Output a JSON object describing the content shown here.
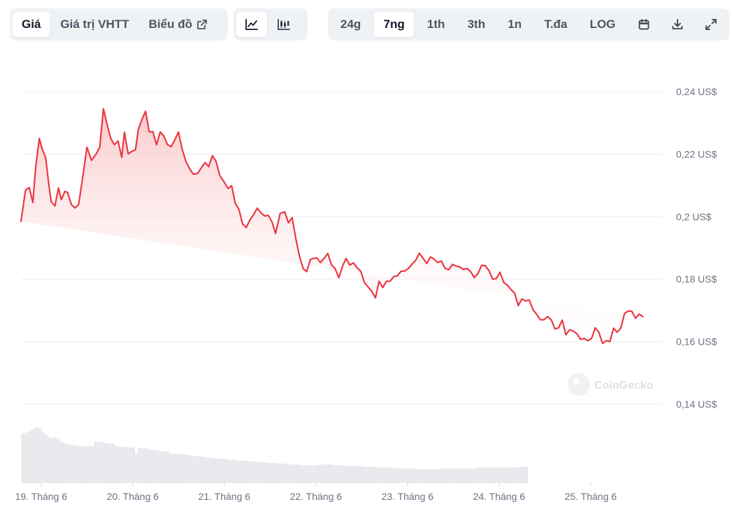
{
  "toolbar": {
    "tabs": [
      {
        "label": "Giá",
        "active": true
      },
      {
        "label": "Giá trị VHTT",
        "active": false
      },
      {
        "label": "Biểu đồ",
        "active": false
      }
    ],
    "chart_types": [
      {
        "icon": "line-chart-icon",
        "active": true
      },
      {
        "icon": "candlestick-chart-icon",
        "active": false
      }
    ],
    "ranges": [
      {
        "label": "24g",
        "active": false
      },
      {
        "label": "7ng",
        "active": true
      },
      {
        "label": "1th",
        "active": false
      },
      {
        "label": "3th",
        "active": false
      },
      {
        "label": "1n",
        "active": false
      },
      {
        "label": "T.đa",
        "active": false
      },
      {
        "label": "LOG",
        "active": false
      }
    ],
    "tools": [
      "calendar-icon",
      "download-icon",
      "expand-icon"
    ]
  },
  "watermark": "CoinGecko",
  "colors": {
    "line": "#ea3943",
    "fill_top": "#fbc7c9",
    "grid": "#eceef1",
    "volume": "#e6e8ec",
    "axis_text": "#6b7280"
  },
  "chart_data": {
    "type": "area",
    "y_tick_labels": [
      "0,24 US$",
      "0,22 US$",
      "0,2 US$",
      "0,18 US$",
      "0,16 US$",
      "0,14 US$"
    ],
    "y_ticks": [
      0.24,
      0.22,
      0.2,
      0.18,
      0.16,
      0.14
    ],
    "ylim": [
      0.14,
      0.24
    ],
    "xlim": [
      18.78,
      25.78
    ],
    "x_tick_labels": [
      "19. Tháng 6",
      "20. Tháng 6",
      "21. Tháng 6",
      "22. Tháng 6",
      "23. Tháng 6",
      "24. Tháng 6",
      "25. Tháng 6"
    ],
    "x_ticks": [
      19,
      20,
      21,
      22,
      23,
      24,
      25
    ],
    "grid": true,
    "price": {
      "x": [
        18.78,
        18.83,
        18.87,
        18.91,
        18.94,
        18.98,
        19.01,
        19.05,
        19.08,
        19.11,
        19.15,
        19.19,
        19.22,
        19.26,
        19.29,
        19.33,
        19.37,
        19.41,
        19.46,
        19.5,
        19.55,
        19.6,
        19.64,
        19.68,
        19.72,
        19.76,
        19.8,
        19.84,
        19.88,
        19.91,
        19.95,
        19.98,
        20.03,
        20.06,
        20.1,
        20.14,
        20.18,
        20.22,
        20.26,
        20.3,
        20.34,
        20.38,
        20.42,
        20.46,
        20.5,
        20.54,
        20.58,
        20.62,
        20.66,
        20.71,
        20.75,
        20.79,
        20.83,
        20.87,
        20.91,
        20.95,
        21.0,
        21.04,
        21.08,
        21.12,
        21.16,
        21.2,
        21.24,
        21.28,
        21.32,
        21.36,
        21.4,
        21.44,
        21.48,
        21.52,
        21.56,
        21.61,
        21.66,
        21.7,
        21.74,
        21.78,
        21.82,
        21.86,
        21.9,
        21.94,
        21.97,
        22.01,
        22.05,
        22.09,
        22.13,
        22.17,
        22.21,
        22.25,
        22.29,
        22.33,
        22.37,
        22.41,
        22.45,
        22.49,
        22.53,
        22.57,
        22.61,
        22.65,
        22.69,
        22.73,
        22.77,
        22.81,
        22.85,
        22.89,
        22.93,
        22.97,
        23.01,
        23.05,
        23.09,
        23.13,
        23.17,
        23.21,
        23.25,
        23.29,
        23.33,
        23.37,
        23.41,
        23.45,
        23.49,
        23.53,
        23.57,
        23.61,
        23.65,
        23.69,
        23.73,
        23.77,
        23.81,
        23.85,
        23.89,
        23.93,
        23.97,
        24.01,
        24.05,
        24.09,
        24.13,
        24.17,
        24.21,
        24.25,
        24.29,
        24.33,
        24.37,
        24.41,
        24.45,
        24.49,
        24.53,
        24.57,
        24.61,
        24.65,
        24.69,
        24.73,
        24.77,
        24.81,
        24.85,
        24.89,
        24.93,
        24.97,
        25.01,
        25.05,
        25.09,
        25.13,
        25.17,
        25.21,
        25.25,
        25.29,
        25.33,
        25.37,
        25.41,
        25.45,
        25.49,
        25.53,
        25.57,
        25.61,
        25.65,
        25.69,
        25.73,
        25.77
      ],
      "y": [
        0.1985,
        0.2085,
        0.2093,
        0.2045,
        0.2158,
        0.225,
        0.2218,
        0.2188,
        0.2112,
        0.2048,
        0.2034,
        0.2092,
        0.2054,
        0.2081,
        0.2077,
        0.2039,
        0.2028,
        0.2039,
        0.2138,
        0.2222,
        0.218,
        0.22,
        0.2222,
        0.2345,
        0.2296,
        0.225,
        0.223,
        0.2242,
        0.219,
        0.227,
        0.2201,
        0.2207,
        0.2214,
        0.2277,
        0.231,
        0.2337,
        0.2271,
        0.2272,
        0.223,
        0.2271,
        0.2258,
        0.223,
        0.2224,
        0.2246,
        0.2271,
        0.2215,
        0.2177,
        0.2154,
        0.2136,
        0.2138,
        0.2157,
        0.2173,
        0.216,
        0.2195,
        0.2177,
        0.2132,
        0.211,
        0.209,
        0.2099,
        0.2043,
        0.2023,
        0.1976,
        0.1965,
        0.199,
        0.2006,
        0.2027,
        0.2012,
        0.2002,
        0.2004,
        0.1984,
        0.1946,
        0.201,
        0.2015,
        0.198,
        0.1997,
        0.1931,
        0.1875,
        0.1834,
        0.1824,
        0.1863,
        0.1866,
        0.1868,
        0.1853,
        0.1867,
        0.1882,
        0.1846,
        0.1834,
        0.1804,
        0.1841,
        0.1866,
        0.1845,
        0.1852,
        0.1836,
        0.1825,
        0.1789,
        0.1775,
        0.1761,
        0.174,
        0.1793,
        0.1773,
        0.1793,
        0.1793,
        0.1808,
        0.1811,
        0.1825,
        0.1826,
        0.1834,
        0.1848,
        0.186,
        0.1883,
        0.1867,
        0.185,
        0.1871,
        0.1864,
        0.1853,
        0.1858,
        0.1835,
        0.183,
        0.1847,
        0.1842,
        0.1839,
        0.1831,
        0.1834,
        0.1824,
        0.1805,
        0.1818,
        0.1844,
        0.1843,
        0.1827,
        0.18,
        0.1802,
        0.1822,
        0.179,
        0.1781,
        0.1767,
        0.1755,
        0.1715,
        0.1737,
        0.173,
        0.1733,
        0.1702,
        0.1688,
        0.167,
        0.167,
        0.168,
        0.167,
        0.1641,
        0.1644,
        0.1669,
        0.1622,
        0.1638,
        0.1634,
        0.1625,
        0.1607,
        0.161,
        0.1603,
        0.161,
        0.1644,
        0.163,
        0.1594,
        0.1603,
        0.16,
        0.1643,
        0.163,
        0.1644,
        0.169,
        0.1698,
        0.1697,
        0.1675,
        0.1688,
        0.168
      ]
    },
    "volume": {
      "x_start": 18.8,
      "x_step": 0.0318,
      "values": [
        0.64,
        0.65,
        0.66,
        0.68,
        0.7,
        0.72,
        0.7,
        0.66,
        0.62,
        0.6,
        0.58,
        0.59,
        0.57,
        0.54,
        0.52,
        0.5,
        0.5,
        0.49,
        0.49,
        0.48,
        0.48,
        0.47,
        0.47,
        0.48,
        0.48,
        0.54,
        0.53,
        0.53,
        0.52,
        0.52,
        0.51,
        0.51,
        0.48,
        0.47,
        0.47,
        0.47,
        0.46,
        0.46,
        0.46,
        0.38,
        0.46,
        0.45,
        0.45,
        0.44,
        0.43,
        0.43,
        0.42,
        0.42,
        0.41,
        0.41,
        0.4,
        0.38,
        0.38,
        0.38,
        0.38,
        0.37,
        0.37,
        0.36,
        0.36,
        0.35,
        0.35,
        0.34,
        0.34,
        0.33,
        0.33,
        0.32,
        0.32,
        0.32,
        0.31,
        0.31,
        0.31,
        0.3,
        0.3,
        0.3,
        0.29,
        0.29,
        0.29,
        0.28,
        0.28,
        0.28,
        0.28,
        0.27,
        0.27,
        0.27,
        0.26,
        0.26,
        0.26,
        0.26,
        0.25,
        0.25,
        0.25,
        0.25,
        0.24,
        0.24,
        0.24,
        0.24,
        0.23,
        0.23,
        0.23,
        0.23,
        0.23,
        0.23,
        0.24,
        0.24,
        0.24,
        0.24,
        0.24,
        0.23,
        0.23,
        0.23,
        0.23,
        0.22,
        0.22,
        0.22,
        0.22,
        0.22,
        0.22,
        0.21,
        0.21,
        0.21,
        0.21,
        0.21,
        0.2,
        0.2,
        0.2,
        0.2,
        0.2,
        0.2,
        0.19,
        0.19,
        0.19,
        0.19,
        0.19,
        0.19,
        0.19,
        0.18,
        0.18,
        0.18,
        0.18,
        0.18,
        0.18,
        0.18,
        0.18,
        0.18,
        0.19,
        0.19,
        0.19,
        0.19,
        0.19,
        0.19,
        0.19,
        0.19,
        0.19,
        0.19,
        0.19,
        0.19,
        0.2,
        0.2,
        0.2,
        0.2,
        0.2,
        0.2,
        0.2,
        0.2,
        0.2,
        0.2,
        0.2,
        0.2,
        0.2,
        0.2,
        0.21,
        0.21,
        0.21,
        0.21
      ]
    }
  }
}
